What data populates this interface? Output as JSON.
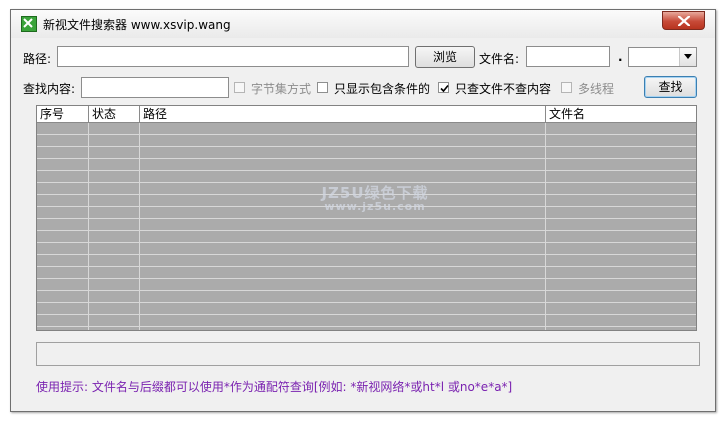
{
  "window": {
    "title": "新视文件搜索器   www.xsvip.wang"
  },
  "controls": {
    "path_label": "路径:",
    "path_value": "",
    "browse_label": "浏览",
    "filename_label": "文件名:",
    "filename_value": "",
    "dot": ".",
    "ext_value": "",
    "content_label": "查找内容:",
    "content_value": "",
    "charset_label": "字节集方式",
    "show_match_label": "只显示包含条件的",
    "only_file_label": "只查文件不查内容",
    "multithread_label": "多线程",
    "search_label": "查找"
  },
  "checkboxes": {
    "charset_checked": false,
    "charset_enabled": false,
    "show_match_checked": false,
    "only_file_checked": true,
    "multithread_checked": false,
    "multithread_enabled": false
  },
  "table": {
    "headers": [
      "序号",
      "状态",
      "路径",
      "文件名"
    ]
  },
  "watermark": {
    "line1": "JZ5U绿色下载",
    "line2": "www.jz5u.com"
  },
  "status_text": "",
  "tip": "使用提示: 文件名与后缀都可以使用*作为通配符查询[例如: *新视网络*或ht*l 或no*e*a*]",
  "colors": {
    "tip": "#7a22b0",
    "grid_bg": "#ababab",
    "close": "#c74a38"
  }
}
